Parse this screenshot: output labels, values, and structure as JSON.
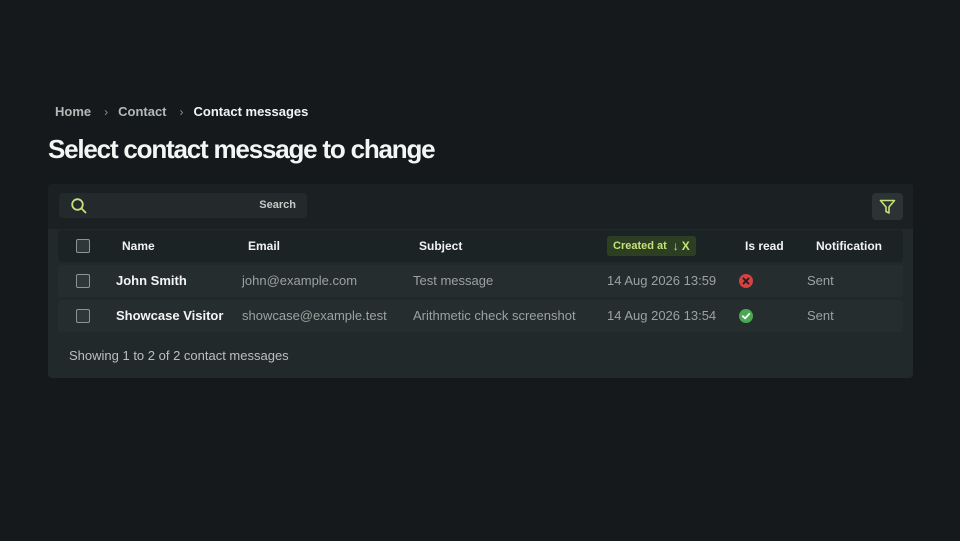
{
  "breadcrumb": {
    "items": [
      "Home",
      "Contact",
      "Contact messages"
    ],
    "separator": "›"
  },
  "page_title": "Select contact message to change",
  "search": {
    "placeholder": "",
    "button_label": "Search"
  },
  "table": {
    "columns": {
      "name": "Name",
      "email": "Email",
      "subject": "Subject",
      "created_at": "Created at",
      "is_read": "Is read",
      "notification": "Notification"
    },
    "sort_indicator": "↓",
    "sort_clear": "X",
    "rows": [
      {
        "name": "John Smith",
        "email": "john@example.com",
        "subject": "Test message",
        "created_at": "14 Aug 2026 13:59",
        "is_read": false,
        "is_read_icon": "x-circle-icon",
        "notification": "Sent"
      },
      {
        "name": "Showcase Visitor",
        "email": "showcase@example.test",
        "subject": "Arithmetic check screenshot",
        "created_at": "14 Aug 2026 13:54",
        "is_read": true,
        "is_read_icon": "check-circle-icon",
        "notification": "Sent"
      }
    ]
  },
  "footer": "Showing 1 to 2 of 2 contact messages",
  "colors": {
    "background": "#15191c",
    "accent": "#c6e07a",
    "false_icon": "#d64141",
    "true_icon": "#4aa853"
  }
}
